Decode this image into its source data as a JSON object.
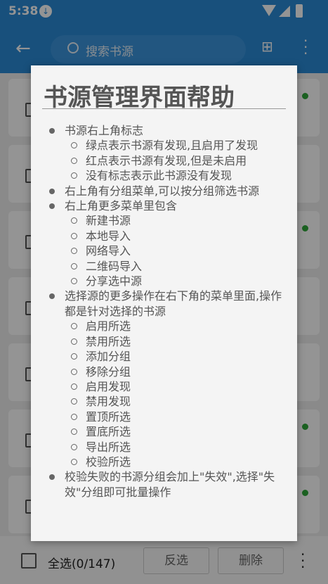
{
  "status_bar": {
    "time": "5:38"
  },
  "toolbar": {
    "search_placeholder": "搜索书源"
  },
  "list": {
    "rows": [
      {
        "has_dot": true
      },
      {
        "has_dot": false
      },
      {
        "has_dot": true
      },
      {
        "has_dot": false
      },
      {
        "has_dot": false
      },
      {
        "has_dot": true
      },
      {
        "has_dot": true
      }
    ]
  },
  "bottom_bar": {
    "select_all_label": "全选(0/147)",
    "invert_label": "反选",
    "delete_label": "删除"
  },
  "dialog": {
    "title": "书源管理界面帮助",
    "items": [
      {
        "text": "书源右上角标志",
        "sub": [
          "绿点表示书源有发现,且启用了发现",
          "红点表示书源有发现,但是未启用",
          "没有标志表示此书源没有发现"
        ]
      },
      {
        "text": "右上角有分组菜单,可以按分组筛选书源",
        "sub": []
      },
      {
        "text": "右上角更多菜单里包含",
        "sub": [
          "新建书源",
          "本地导入",
          "网络导入",
          "二维码导入",
          "分享选中源"
        ]
      },
      {
        "text": "选择源的更多操作在右下角的菜单里面,操作都是针对选择的书源",
        "sub": [
          "启用所选",
          "禁用所选",
          "添加分组",
          "移除分组",
          "启用发现",
          "禁用发现",
          "置顶所选",
          "置底所选",
          "导出所选",
          "校验所选"
        ]
      },
      {
        "text": "校验失败的书源分组会加上\"失效\",选择\"失效\"分组即可批量操作",
        "sub": []
      }
    ]
  },
  "colors": {
    "primary": "#2a8ad6",
    "dot_green": "#2fa83a"
  }
}
